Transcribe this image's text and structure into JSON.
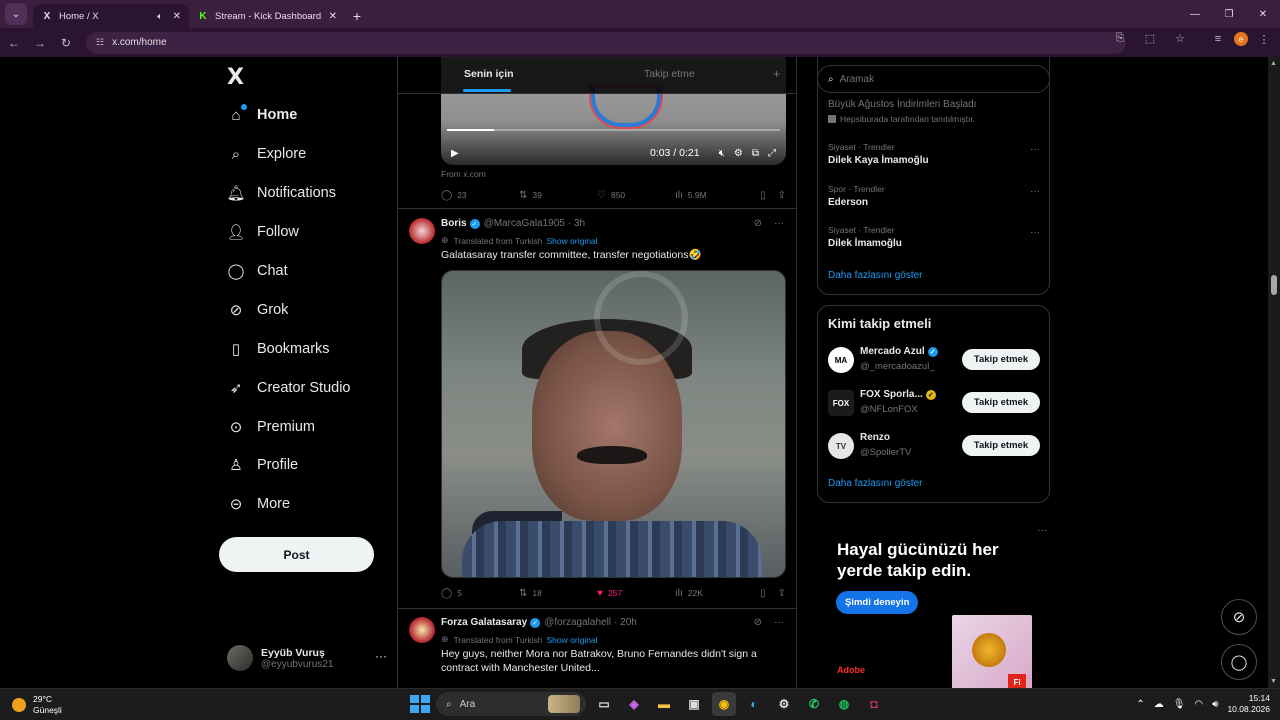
{
  "browser": {
    "tabs": [
      {
        "title": "Home / X",
        "favicon": "X",
        "active": true
      },
      {
        "title": "Stream - Kick Dashboard",
        "favicon": "K",
        "active": false
      }
    ],
    "url": "x.com/home",
    "profile_initial": "e"
  },
  "sidebar": {
    "logo": "X",
    "items": [
      {
        "label": "Home",
        "icon": "home-icon",
        "glyph": "⌂"
      },
      {
        "label": "Explore",
        "icon": "search-icon",
        "glyph": "⌕"
      },
      {
        "label": "Notifications",
        "icon": "bell-icon",
        "glyph": "🔔︎"
      },
      {
        "label": "Follow",
        "icon": "person-add-icon",
        "glyph": "👤︎"
      },
      {
        "label": "Chat",
        "icon": "chat-bubble-icon",
        "glyph": "◯"
      },
      {
        "label": "Grok",
        "icon": "grok-icon",
        "glyph": "⊘"
      },
      {
        "label": "Bookmarks",
        "icon": "bookmark-icon",
        "glyph": "▯"
      },
      {
        "label": "Creator Studio",
        "icon": "rocket-icon",
        "glyph": "➶"
      },
      {
        "label": "Premium",
        "icon": "verified-badge-icon",
        "glyph": "⊙"
      },
      {
        "label": "Profile",
        "icon": "profile-icon",
        "glyph": "♙"
      },
      {
        "label": "More",
        "icon": "more-circle-icon",
        "glyph": "⊝"
      }
    ],
    "post_label": "Post",
    "account": {
      "name": "Eyyüb Vuruş",
      "handle": "@eyyubvurus21"
    }
  },
  "feed": {
    "tabs": {
      "active": "Senin için",
      "inactive": "Takip etme"
    },
    "tweet1": {
      "video_time": "0:03 / 0:21",
      "video_progress": 0.14,
      "source": "From x.com",
      "replies": "23",
      "reposts": "39",
      "likes": "850",
      "views": "5.9M"
    },
    "tweet2": {
      "name": "Boris",
      "handle": "@MarcaGala1905",
      "time": "· 3h",
      "translated": "Translated from Turkish",
      "show_original": "Show original",
      "text": "Galatasaray transfer committee, transfer negotiations🤣",
      "replies": "5",
      "reposts": "18",
      "likes": "257",
      "views": "22K"
    },
    "tweet3": {
      "name": "Forza Galatasaray",
      "handle": "@forzagalahell",
      "time": "· 20h",
      "translated": "Translated from Turkish",
      "show_original": "Show original",
      "text": "Hey guys, neither Mora nor Batrakov, Bruno Fernandes didn't sign a contract with Manchester United..."
    }
  },
  "right": {
    "search_placeholder": "Aramak",
    "promo_title": "Büyük Ağustos İndirimleri Başladı",
    "promo_by": "Hepsiburada tarafından tanıtılmıştır.",
    "trends": [
      {
        "category": "Siyaset · Trendler",
        "title": "Dilek Kaya İmamoğlu"
      },
      {
        "category": "Spor · Trendler",
        "title": "Ederson"
      },
      {
        "category": "Siyaset · Trendler",
        "title": "Dilek İmamoğlu"
      }
    ],
    "show_more": "Daha fazlasını göster",
    "wtf_title": "Kimi takip etmeli",
    "suggestions": [
      {
        "name": "Mercado Azul",
        "handle": "@_mercadoazul_",
        "avatar": "MA",
        "button": "Takip etmek"
      },
      {
        "name": "FOX Sporla...",
        "handle": "@NFLonFOX",
        "avatar": "FOX",
        "button": "Takip etmek"
      },
      {
        "name": "Renzo",
        "handle": "@SpollerTV",
        "avatar": "TV",
        "button": "Takip etmek"
      }
    ],
    "ad": {
      "headline": "Hayal gücünüzü her yerde takip edin.",
      "cta": "Şimdi deneyin",
      "brand": "Adobe",
      "badge": "Fi"
    }
  },
  "taskbar": {
    "temperature": "29°C",
    "condition": "Güneşli",
    "search_placeholder": "Ara",
    "time": "15:14",
    "date": "10.08.2026"
  },
  "colors": {
    "accent": "#1d9bf0",
    "like": "#f91880",
    "chrome": "#3b1f3f"
  }
}
